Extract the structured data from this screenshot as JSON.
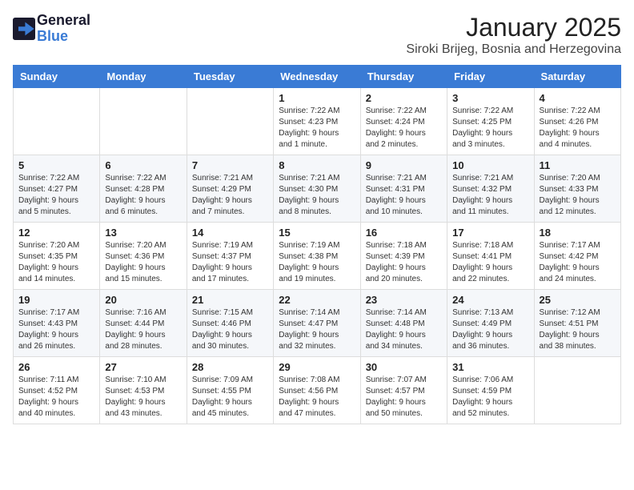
{
  "header": {
    "logo_line1": "General",
    "logo_line2": "Blue",
    "month": "January 2025",
    "location": "Siroki Brijeg, Bosnia and Herzegovina"
  },
  "days_of_week": [
    "Sunday",
    "Monday",
    "Tuesday",
    "Wednesday",
    "Thursday",
    "Friday",
    "Saturday"
  ],
  "weeks": [
    [
      {
        "day": "",
        "info": ""
      },
      {
        "day": "",
        "info": ""
      },
      {
        "day": "",
        "info": ""
      },
      {
        "day": "1",
        "info": "Sunrise: 7:22 AM\nSunset: 4:23 PM\nDaylight: 9 hours\nand 1 minute."
      },
      {
        "day": "2",
        "info": "Sunrise: 7:22 AM\nSunset: 4:24 PM\nDaylight: 9 hours\nand 2 minutes."
      },
      {
        "day": "3",
        "info": "Sunrise: 7:22 AM\nSunset: 4:25 PM\nDaylight: 9 hours\nand 3 minutes."
      },
      {
        "day": "4",
        "info": "Sunrise: 7:22 AM\nSunset: 4:26 PM\nDaylight: 9 hours\nand 4 minutes."
      }
    ],
    [
      {
        "day": "5",
        "info": "Sunrise: 7:22 AM\nSunset: 4:27 PM\nDaylight: 9 hours\nand 5 minutes."
      },
      {
        "day": "6",
        "info": "Sunrise: 7:22 AM\nSunset: 4:28 PM\nDaylight: 9 hours\nand 6 minutes."
      },
      {
        "day": "7",
        "info": "Sunrise: 7:21 AM\nSunset: 4:29 PM\nDaylight: 9 hours\nand 7 minutes."
      },
      {
        "day": "8",
        "info": "Sunrise: 7:21 AM\nSunset: 4:30 PM\nDaylight: 9 hours\nand 8 minutes."
      },
      {
        "day": "9",
        "info": "Sunrise: 7:21 AM\nSunset: 4:31 PM\nDaylight: 9 hours\nand 10 minutes."
      },
      {
        "day": "10",
        "info": "Sunrise: 7:21 AM\nSunset: 4:32 PM\nDaylight: 9 hours\nand 11 minutes."
      },
      {
        "day": "11",
        "info": "Sunrise: 7:20 AM\nSunset: 4:33 PM\nDaylight: 9 hours\nand 12 minutes."
      }
    ],
    [
      {
        "day": "12",
        "info": "Sunrise: 7:20 AM\nSunset: 4:35 PM\nDaylight: 9 hours\nand 14 minutes."
      },
      {
        "day": "13",
        "info": "Sunrise: 7:20 AM\nSunset: 4:36 PM\nDaylight: 9 hours\nand 15 minutes."
      },
      {
        "day": "14",
        "info": "Sunrise: 7:19 AM\nSunset: 4:37 PM\nDaylight: 9 hours\nand 17 minutes."
      },
      {
        "day": "15",
        "info": "Sunrise: 7:19 AM\nSunset: 4:38 PM\nDaylight: 9 hours\nand 19 minutes."
      },
      {
        "day": "16",
        "info": "Sunrise: 7:18 AM\nSunset: 4:39 PM\nDaylight: 9 hours\nand 20 minutes."
      },
      {
        "day": "17",
        "info": "Sunrise: 7:18 AM\nSunset: 4:41 PM\nDaylight: 9 hours\nand 22 minutes."
      },
      {
        "day": "18",
        "info": "Sunrise: 7:17 AM\nSunset: 4:42 PM\nDaylight: 9 hours\nand 24 minutes."
      }
    ],
    [
      {
        "day": "19",
        "info": "Sunrise: 7:17 AM\nSunset: 4:43 PM\nDaylight: 9 hours\nand 26 minutes."
      },
      {
        "day": "20",
        "info": "Sunrise: 7:16 AM\nSunset: 4:44 PM\nDaylight: 9 hours\nand 28 minutes."
      },
      {
        "day": "21",
        "info": "Sunrise: 7:15 AM\nSunset: 4:46 PM\nDaylight: 9 hours\nand 30 minutes."
      },
      {
        "day": "22",
        "info": "Sunrise: 7:14 AM\nSunset: 4:47 PM\nDaylight: 9 hours\nand 32 minutes."
      },
      {
        "day": "23",
        "info": "Sunrise: 7:14 AM\nSunset: 4:48 PM\nDaylight: 9 hours\nand 34 minutes."
      },
      {
        "day": "24",
        "info": "Sunrise: 7:13 AM\nSunset: 4:49 PM\nDaylight: 9 hours\nand 36 minutes."
      },
      {
        "day": "25",
        "info": "Sunrise: 7:12 AM\nSunset: 4:51 PM\nDaylight: 9 hours\nand 38 minutes."
      }
    ],
    [
      {
        "day": "26",
        "info": "Sunrise: 7:11 AM\nSunset: 4:52 PM\nDaylight: 9 hours\nand 40 minutes."
      },
      {
        "day": "27",
        "info": "Sunrise: 7:10 AM\nSunset: 4:53 PM\nDaylight: 9 hours\nand 43 minutes."
      },
      {
        "day": "28",
        "info": "Sunrise: 7:09 AM\nSunset: 4:55 PM\nDaylight: 9 hours\nand 45 minutes."
      },
      {
        "day": "29",
        "info": "Sunrise: 7:08 AM\nSunset: 4:56 PM\nDaylight: 9 hours\nand 47 minutes."
      },
      {
        "day": "30",
        "info": "Sunrise: 7:07 AM\nSunset: 4:57 PM\nDaylight: 9 hours\nand 50 minutes."
      },
      {
        "day": "31",
        "info": "Sunrise: 7:06 AM\nSunset: 4:59 PM\nDaylight: 9 hours\nand 52 minutes."
      },
      {
        "day": "",
        "info": ""
      }
    ]
  ]
}
